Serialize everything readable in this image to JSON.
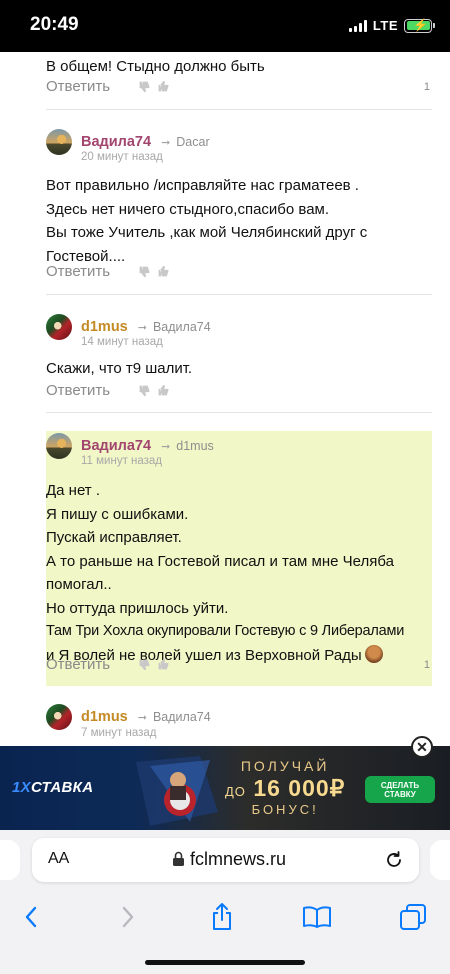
{
  "status_bar": {
    "time": "20:49",
    "network": "LTE"
  },
  "comments": [
    {
      "text_lines": [
        "В общем! Стыдно должно быть"
      ],
      "reply_label": "Ответить",
      "count": "1"
    },
    {
      "author": "Вадила74",
      "reply_to": "Dacar",
      "time": "20 минут назад",
      "text_lines": [
        "Вот правильно /исправляйте нас граматеев .",
        "Здесь нет ничего стыдного,спасибо вам.",
        "Вы тоже Учитель ,как мой Челябинский друг с",
        "Гостевой...."
      ],
      "reply_label": "Ответить"
    },
    {
      "author": "d1mus",
      "reply_to": "Вадила74",
      "time": "14 минут назад",
      "text_lines": [
        "Скажи, что т9 шалит."
      ],
      "reply_label": "Ответить"
    },
    {
      "author": "Вадила74",
      "reply_to": "d1mus",
      "time": "11 минут назад",
      "text_lines": [
        "Да нет .",
        "Я пишу с ошибками.",
        "Пускай исправляет.",
        "А то раньше на Гостевой писал и там мне Челяба",
        "помогал..",
        "Но оттуда пришлось уйти.",
        "Там Три Хохла окупировали Гостевую с 9 Либералами",
        "и Я волей не волей ушел из Верховной Рады"
      ],
      "reply_label": "Ответить",
      "count": "1"
    },
    {
      "author": "d1mus",
      "reply_to": "Вадила74",
      "time": "7 минут назад"
    }
  ],
  "ad": {
    "logo_prefix": "1X",
    "logo_suffix": "СТАВКА",
    "line1": "ПОЛУЧАЙ",
    "line2_prefix": "ДО",
    "line2_amount": "16 000₽",
    "line3": "БОНУС!",
    "button_line1": "СДЕЛАТЬ",
    "button_line2": "СТАВКУ"
  },
  "browser": {
    "aa_label": "AA",
    "domain": "fclmnews.ru"
  },
  "colors": {
    "highlight": "#f1f7c6",
    "author_pink": "#a2456f",
    "author_gold": "#c48a26",
    "ad_button": "#16a54a",
    "ios_blue": "#0a7aff"
  }
}
